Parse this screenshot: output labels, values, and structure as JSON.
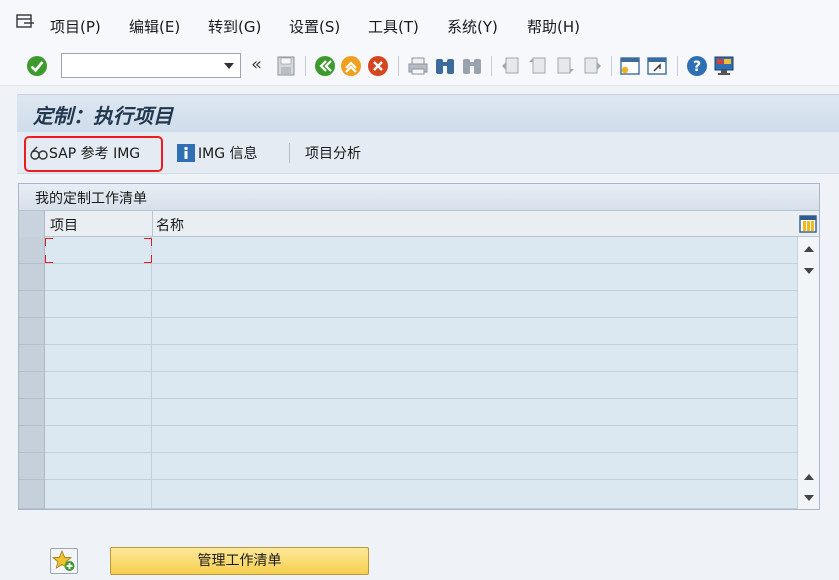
{
  "menu": [
    {
      "label": "项目(P)"
    },
    {
      "label": "编辑(E)"
    },
    {
      "label": "转到(G)"
    },
    {
      "label": "设置(S)"
    },
    {
      "label": "工具(T)"
    },
    {
      "label": "系统(Y)"
    },
    {
      "label": "帮助(H)"
    }
  ],
  "toolbar": {
    "command_value": "",
    "back_glyph": "«"
  },
  "title": "定制：执行项目",
  "app_toolbar": {
    "sap_ref_img": "SAP 参考 IMG",
    "img_info": "IMG 信息",
    "project_analysis": "项目分析"
  },
  "worklist": {
    "title": "我的定制工作清单",
    "columns": [
      "项目",
      "名称"
    ],
    "row_count": 10
  },
  "bottom": {
    "manage_button": "管理工作清单"
  },
  "colors": {
    "highlight": "#ee1c1c",
    "title_text": "#22384f",
    "button_yellow": "#f6cf4e"
  }
}
